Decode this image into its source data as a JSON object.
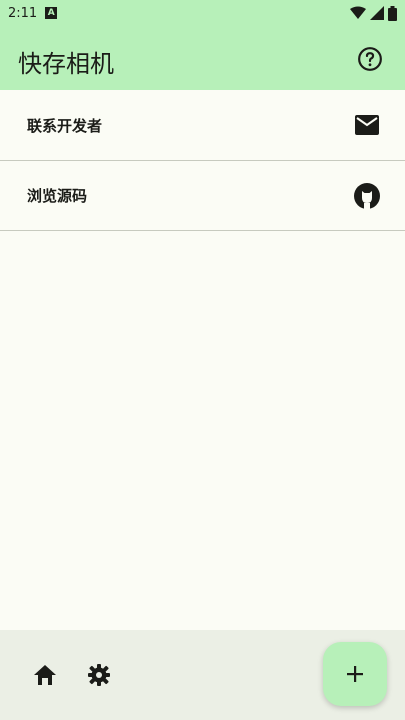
{
  "status": {
    "time": "2:11",
    "notif": "A"
  },
  "app_bar": {
    "title": "快存相机",
    "help_icon": "help-circle-icon"
  },
  "items": [
    {
      "label": "联系开发者",
      "icon": "mail-icon"
    },
    {
      "label": "浏览源码",
      "icon": "github-icon"
    }
  ],
  "bottom_nav": {
    "home_icon": "home-icon",
    "settings_icon": "settings-icon",
    "fab_icon": "plus-icon"
  },
  "colors": {
    "header": "#b7f0b9",
    "background": "#fbfcf5",
    "bottom_bar": "#ebefe5",
    "text": "#1b1c18"
  }
}
